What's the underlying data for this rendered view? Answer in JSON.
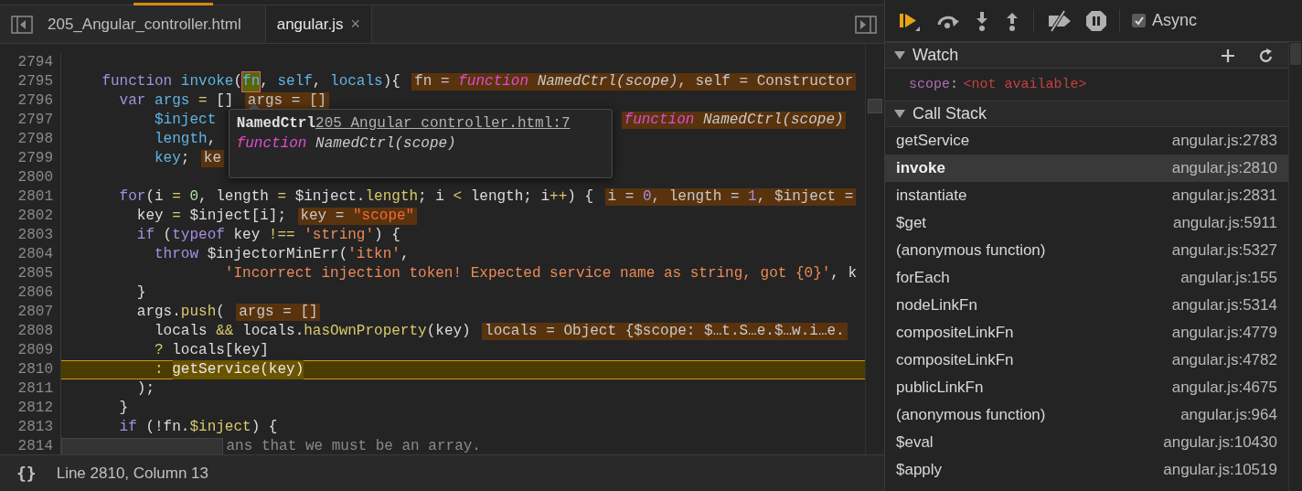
{
  "tabs": [
    {
      "label": "205_Angular_controller.html",
      "selected": false
    },
    {
      "label": "angular.js",
      "selected": true,
      "close": "×"
    }
  ],
  "code": {
    "lines": [
      {
        "number": "2794",
        "kind": "code",
        "current": false
      },
      {
        "number": "2795",
        "kind": "code",
        "current": false,
        "tokens": [
          {
            "text": "    function",
            "kind": "k"
          },
          {
            "text": " invoke",
            "kind": "d"
          },
          {
            "text": "(",
            "kind": "p"
          },
          {
            "text": "fn",
            "kind": "h"
          },
          {
            "text": ", ",
            "kind": "p"
          },
          {
            "text": "self",
            "kind": "d"
          },
          {
            "text": ", ",
            "kind": "p"
          },
          {
            "text": "locals",
            "kind": "d"
          },
          {
            "text": "){",
            "kind": "p"
          }
        ],
        "inline": {
          "segments": [
            {
              "text": "fn = ",
              "kind": "p"
            },
            {
              "text": "function",
              "kind": "f"
            },
            {
              "text": " NamedCtrl(scope)",
              "kind": "i"
            },
            {
              "text": ", self = Constructor",
              "kind": "p"
            }
          ],
          "after_popup": false
        }
      },
      {
        "number": "2796",
        "kind": "code",
        "current": false,
        "tokens": [
          {
            "text": "      var",
            "kind": "k"
          },
          {
            "text": " args",
            "kind": "d"
          },
          {
            "text": " =",
            "kind": "o"
          },
          {
            "text": " []",
            "kind": "p"
          }
        ],
        "inline": {
          "segments": [
            {
              "text": "args = []",
              "kind": "p"
            }
          ],
          "after_popup": false
        }
      },
      {
        "number": "2797",
        "kind": "code",
        "current": false,
        "tokens": [
          {
            "text": "          $inject",
            "kind": "d"
          }
        ],
        "inline": {
          "segments": [
            {
              "text": "function",
              "kind": "f"
            },
            {
              "text": " NamedCtrl(scope)",
              "kind": "i"
            }
          ],
          "after_popup": true
        }
      },
      {
        "number": "2798",
        "kind": "code",
        "current": false,
        "tokens": [
          {
            "text": "          length",
            "kind": "d"
          },
          {
            "text": ",",
            "kind": "p"
          }
        ]
      },
      {
        "number": "2799",
        "kind": "code",
        "current": false,
        "tokens": [
          {
            "text": "          key",
            "kind": "d"
          },
          {
            "text": ";",
            "kind": "p"
          }
        ],
        "inline": {
          "segments": [
            {
              "text": "ke",
              "kind": "p"
            }
          ],
          "after_popup": false
        }
      },
      {
        "number": "2800",
        "kind": "code",
        "current": false
      },
      {
        "number": "2801",
        "kind": "code",
        "current": false,
        "tokens": [
          {
            "text": "      for",
            "kind": "k"
          },
          {
            "text": "(i",
            "kind": "p"
          },
          {
            "text": " =",
            "kind": "o"
          },
          {
            "text": " 0",
            "kind": "n"
          },
          {
            "text": ", length",
            "kind": "p"
          },
          {
            "text": " =",
            "kind": "o"
          },
          {
            "text": " $inject.",
            "kind": "p"
          },
          {
            "text": "length",
            "kind": "o"
          },
          {
            "text": "; i",
            "kind": "p"
          },
          {
            "text": " <",
            "kind": "o"
          },
          {
            "text": " length; i",
            "kind": "p"
          },
          {
            "text": "++",
            "kind": "o"
          },
          {
            "text": ") {",
            "kind": "p"
          }
        ],
        "inline": {
          "segments": [
            {
              "text": "i = ",
              "kind": "p"
            },
            {
              "text": "0",
              "kind": "n"
            },
            {
              "text": ", length = ",
              "kind": "p"
            },
            {
              "text": "1",
              "kind": "n"
            },
            {
              "text": ", $inject =",
              "kind": "p"
            }
          ],
          "after_popup": false
        }
      },
      {
        "number": "2802",
        "kind": "code",
        "current": false,
        "tokens": [
          {
            "text": "        key",
            "kind": "p"
          },
          {
            "text": " =",
            "kind": "o"
          },
          {
            "text": " $inject[i];",
            "kind": "p"
          }
        ],
        "inline": {
          "segments": [
            {
              "text": "key = ",
              "kind": "p"
            },
            {
              "text": "\"scope\"",
              "kind": "s"
            }
          ],
          "after_popup": false
        }
      },
      {
        "number": "2803",
        "kind": "code",
        "current": false,
        "tokens": [
          {
            "text": "        if",
            "kind": "k"
          },
          {
            "text": " (",
            "kind": "p"
          },
          {
            "text": "typeof",
            "kind": "k"
          },
          {
            "text": " key",
            "kind": "p"
          },
          {
            "text": " !==",
            "kind": "o"
          },
          {
            "text": " 'string'",
            "kind": "s"
          },
          {
            "text": ") {",
            "kind": "p"
          }
        ]
      },
      {
        "number": "2804",
        "kind": "code",
        "current": false,
        "tokens": [
          {
            "text": "          throw",
            "kind": "k"
          },
          {
            "text": " $injectorMinErr(",
            "kind": "p"
          },
          {
            "text": "'itkn'",
            "kind": "s"
          },
          {
            "text": ",",
            "kind": "p"
          }
        ]
      },
      {
        "number": "2805",
        "kind": "code",
        "current": false,
        "tokens": [
          {
            "text": "                  'Incorrect injection token! Expected service name as string, got {0}'",
            "kind": "s"
          },
          {
            "text": ", k",
            "kind": "p"
          }
        ]
      },
      {
        "number": "2806",
        "kind": "code",
        "current": false,
        "tokens": [
          {
            "text": "        }",
            "kind": "p"
          }
        ]
      },
      {
        "number": "2807",
        "kind": "code",
        "current": false,
        "tokens": [
          {
            "text": "        args.",
            "kind": "p"
          },
          {
            "text": "push",
            "kind": "o"
          },
          {
            "text": "(",
            "kind": "p"
          }
        ],
        "inline": {
          "segments": [
            {
              "text": "args = []",
              "kind": "p"
            }
          ],
          "after_popup": false
        }
      },
      {
        "number": "2808",
        "kind": "code",
        "current": false,
        "tokens": [
          {
            "text": "          locals",
            "kind": "p"
          },
          {
            "text": " &&",
            "kind": "o"
          },
          {
            "text": " locals.",
            "kind": "p"
          },
          {
            "text": "hasOwnProperty",
            "kind": "o"
          },
          {
            "text": "(key)",
            "kind": "p"
          }
        ],
        "inline": {
          "segments": [
            {
              "text": "locals = Object {$scope: $…t.S…e.$…w.i…e.",
              "kind": "p"
            }
          ],
          "after_popup": false
        }
      },
      {
        "number": "2809",
        "kind": "code",
        "current": false,
        "tokens": [
          {
            "text": "          ?",
            "kind": "o"
          },
          {
            "text": " locals[key]",
            "kind": "p"
          }
        ]
      },
      {
        "number": "2810",
        "kind": "code",
        "current": true,
        "tokens": [
          {
            "text": "          :",
            "kind": "o"
          },
          {
            "text": " getService(key)",
            "kind": "x"
          }
        ]
      },
      {
        "number": "2811",
        "kind": "code",
        "current": false,
        "tokens": [
          {
            "text": "        );",
            "kind": "p"
          }
        ]
      },
      {
        "number": "2812",
        "kind": "code",
        "current": false,
        "tokens": [
          {
            "text": "      }",
            "kind": "p"
          }
        ]
      },
      {
        "number": "2813",
        "kind": "code",
        "current": false,
        "tokens": [
          {
            "text": "      if",
            "kind": "k"
          },
          {
            "text": " (!fn.",
            "kind": "p"
          },
          {
            "text": "$inject",
            "kind": "o"
          },
          {
            "text": ") {",
            "kind": "p"
          }
        ]
      },
      {
        "number": "2814",
        "kind": "under-scrollbar",
        "current": false,
        "tokens": [
          {
            "text": "ans that we must be an array.",
            "kind": "c"
          }
        ]
      }
    ]
  },
  "popup": {
    "title": "NamedCtrl",
    "link": "205_Angular_controller.html:7",
    "signature": [
      {
        "text": "function",
        "kind": "f"
      },
      {
        "text": " NamedCtrl(scope)",
        "kind": "i"
      }
    ]
  },
  "status_bar": {
    "icon": "{}",
    "position": "Line 2810, Column 13"
  },
  "debugger": {
    "async": {
      "label": "Async",
      "checked": true
    },
    "watch": {
      "title": "Watch",
      "expanded": true,
      "items": [
        {
          "name": "scope",
          "separator": ":",
          "value": "<not available>"
        }
      ]
    },
    "call_stack": {
      "title": "Call Stack",
      "expanded": true,
      "frames": [
        {
          "name": "getService",
          "location": "angular.js:2783",
          "selected": false
        },
        {
          "name": "invoke",
          "location": "angular.js:2810",
          "selected": true
        },
        {
          "name": "instantiate",
          "location": "angular.js:2831",
          "selected": false
        },
        {
          "name": "$get",
          "location": "angular.js:5911",
          "selected": false
        },
        {
          "name": "(anonymous function)",
          "location": "angular.js:5327",
          "selected": false
        },
        {
          "name": "forEach",
          "location": "angular.js:155",
          "selected": false
        },
        {
          "name": "nodeLinkFn",
          "location": "angular.js:5314",
          "selected": false
        },
        {
          "name": "compositeLinkFn",
          "location": "angular.js:4779",
          "selected": false
        },
        {
          "name": "compositeLinkFn",
          "location": "angular.js:4782",
          "selected": false
        },
        {
          "name": "publicLinkFn",
          "location": "angular.js:4675",
          "selected": false
        },
        {
          "name": "(anonymous function)",
          "location": "angular.js:964",
          "selected": false
        },
        {
          "name": "$eval",
          "location": "angular.js:10430",
          "selected": false
        },
        {
          "name": "$apply",
          "location": "angular.js:10519",
          "selected": false
        }
      ]
    }
  }
}
